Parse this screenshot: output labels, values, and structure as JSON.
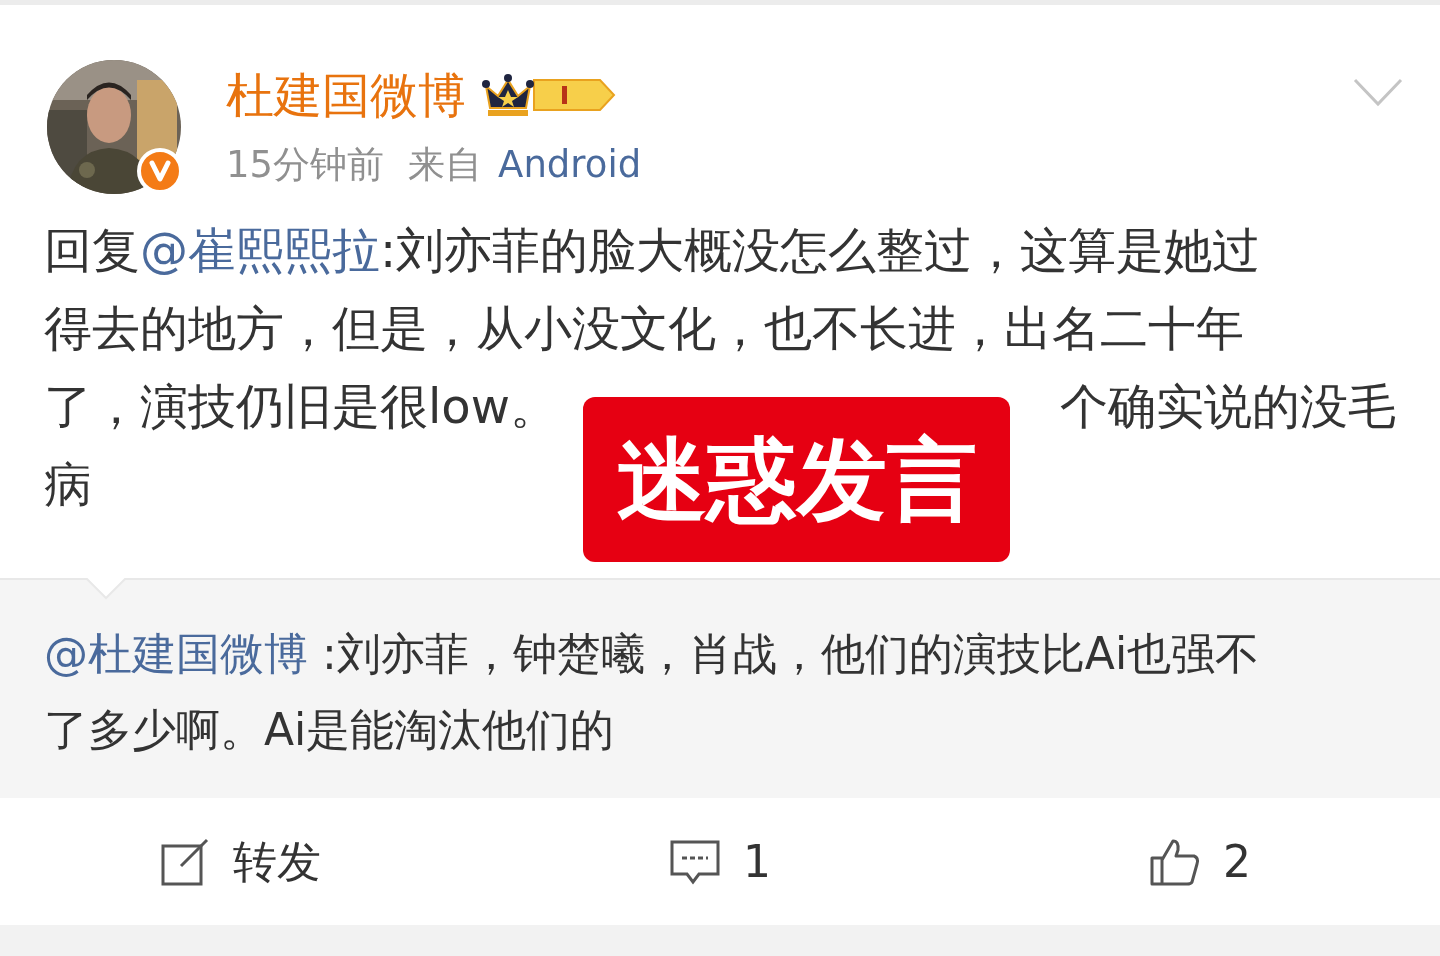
{
  "post": {
    "author": "杜建国微博",
    "time": "15分钟前",
    "source_label": "来自",
    "source": "Android",
    "lines": [
      [
        {
          "text": "回复",
          "kind": "plain"
        },
        {
          "text": "@崔熙熙拉",
          "kind": "mention"
        },
        {
          "text": ":刘亦菲的脸大概没怎么整过，这算是她过",
          "kind": "plain"
        }
      ],
      [
        {
          "text": "得去的地方，但是，从小没文化，也不长进，出名二十年",
          "kind": "plain"
        }
      ],
      [
        {
          "text": "了，演技仍旧是很low。",
          "kind": "plain"
        },
        {
          "text": "个确实说的没毛",
          "kind": "plain"
        }
      ],
      [
        {
          "text": "病",
          "kind": "plain"
        }
      ]
    ],
    "sticker": "迷惑发言"
  },
  "quoted": {
    "lines": [
      [
        {
          "text": "@杜建国微博",
          "kind": "mention"
        },
        {
          "text": " :刘亦菲，钟楚曦，肖战，他们的演技比Ai也强不",
          "kind": "plain"
        }
      ],
      [
        {
          "text": "了多少啊。Ai是能淘汰他们的",
          "kind": "plain"
        }
      ]
    ]
  },
  "actions": [
    {
      "kind": "repost",
      "label": "转发"
    },
    {
      "kind": "comment",
      "label": "1"
    },
    {
      "kind": "like",
      "label": "2"
    }
  ]
}
